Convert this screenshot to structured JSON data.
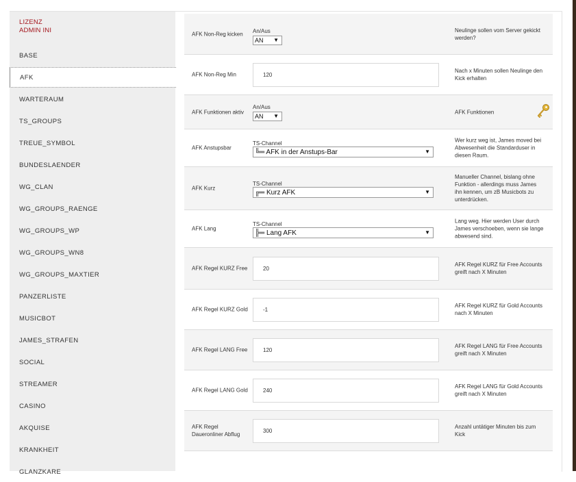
{
  "sidebar": {
    "top_links": [
      "LIZENZ",
      "ADMIN INI"
    ],
    "items": [
      {
        "label": "BASE",
        "active": false
      },
      {
        "label": "AFK",
        "active": true
      },
      {
        "label": "WARTERAUM",
        "active": false
      },
      {
        "label": "TS_GROUPS",
        "active": false
      },
      {
        "label": "TREUE_SYMBOL",
        "active": false
      },
      {
        "label": "BUNDESLAENDER",
        "active": false
      },
      {
        "label": "WG_CLAN",
        "active": false
      },
      {
        "label": "WG_GROUPS_RAENGE",
        "active": false
      },
      {
        "label": "WG_GROUPS_WP",
        "active": false
      },
      {
        "label": "WG_GROUPS_WN8",
        "active": false
      },
      {
        "label": "WG_GROUPS_MAXTIER",
        "active": false
      },
      {
        "label": "PANZERLISTE",
        "active": false
      },
      {
        "label": "MUSICBOT",
        "active": false
      },
      {
        "label": "JAMES_STRAFEN",
        "active": false
      },
      {
        "label": "SOCIAL",
        "active": false
      },
      {
        "label": "STREAMER",
        "active": false
      },
      {
        "label": "CASINO",
        "active": false
      },
      {
        "label": "AKQUISE",
        "active": false
      },
      {
        "label": "KRANKHEIT",
        "active": false
      },
      {
        "label": "GLANZKARE",
        "active": false
      }
    ]
  },
  "settings": [
    {
      "label": "AFK Non-Reg kicken",
      "type": "toggle",
      "caption": "An/Aus",
      "value": "AN",
      "help": "Neulinge sollen vom Server gekickt werden?"
    },
    {
      "label": "AFK Non-Reg Min",
      "type": "text",
      "value": "120",
      "help": "Nach x Minuten sollen Neulinge den Kick erhalten"
    },
    {
      "label": "AFK Funktionen aktiv",
      "type": "toggle",
      "caption": "An/Aus",
      "value": "AN",
      "help": "AFK Funktionen",
      "icon": "key-icon"
    },
    {
      "label": "AFK Anstupsbar",
      "type": "channel",
      "caption": "TS-Channel",
      "value": "╚═ AFK in der Anstups-Bar",
      "help": "Wer kurz weg ist, James moved bei Abwesenheit die Standarduser in diesen Raum."
    },
    {
      "label": "AFK Kurz",
      "type": "channel",
      "caption": "TS-Channel",
      "value": "╔═ Kurz AFK",
      "help": "Manueller Channel, bislang ohne Funktion - allerdings muss James ihn kennen, um zB Musicbots zu unterdrücken."
    },
    {
      "label": "AFK Lang",
      "type": "channel",
      "caption": "TS-Channel",
      "value": "╠═ Lang AFK",
      "help": "Lang weg. Hier werden User durch James verschoeben, wenn sie lange abwesend sind."
    },
    {
      "label": "AFK Regel KURZ Free",
      "type": "text",
      "value": "20",
      "help": "AFK Regel KURZ für Free Accounts greift nach X Minuten"
    },
    {
      "label": "AFK Regel KURZ Gold",
      "type": "text",
      "value": "-1",
      "help": "AFK Regel KURZ für Gold Accounts nach X Minuten"
    },
    {
      "label": "AFK Regel LANG Free",
      "type": "text",
      "value": "120",
      "help": "AFK Regel LANG für Free Accounts greift nach X Minuten"
    },
    {
      "label": "AFK Regel LANG Gold",
      "type": "text",
      "value": "240",
      "help": "AFK Regel LANG für Gold Accounts greift nach X Minuten"
    },
    {
      "label": "AFK Regel Daueronliner Abflug",
      "type": "text",
      "value": "300",
      "help": "Anzahl untätiger Minuten bis zum Kick"
    }
  ],
  "colors": {
    "accent": "#a3131a",
    "sidebar_bg": "#eeeeee",
    "row_shade": "#f4f4f4"
  }
}
